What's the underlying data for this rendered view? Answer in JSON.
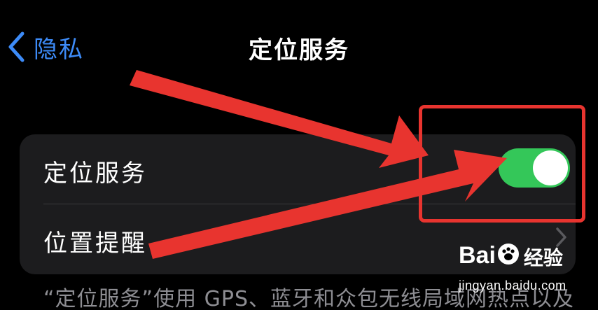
{
  "nav": {
    "back_label": "隐私",
    "title": "定位服务"
  },
  "settings": {
    "rows": [
      {
        "label": "定位服务",
        "control": "toggle",
        "toggle_on": true
      },
      {
        "label": "位置提醒",
        "control": "chevron"
      }
    ]
  },
  "footer": {
    "text": "“定位服务”使用 GPS、蓝牙和众包无线局域网热点以及"
  },
  "watermark": {
    "logo_part1": "Bai",
    "logo_part2": "经验",
    "url": "jingyan.baidu.com"
  },
  "colors": {
    "accent": "#3d8bf7",
    "toggle_on": "#34c759",
    "annotation": "#e8342f",
    "group_bg": "#1c1c1e",
    "secondary_text": "#8e8e93"
  },
  "icons": {
    "back": "chevron-left-icon",
    "disclosure": "chevron-right-icon",
    "watermark_paw": "paw-icon"
  }
}
